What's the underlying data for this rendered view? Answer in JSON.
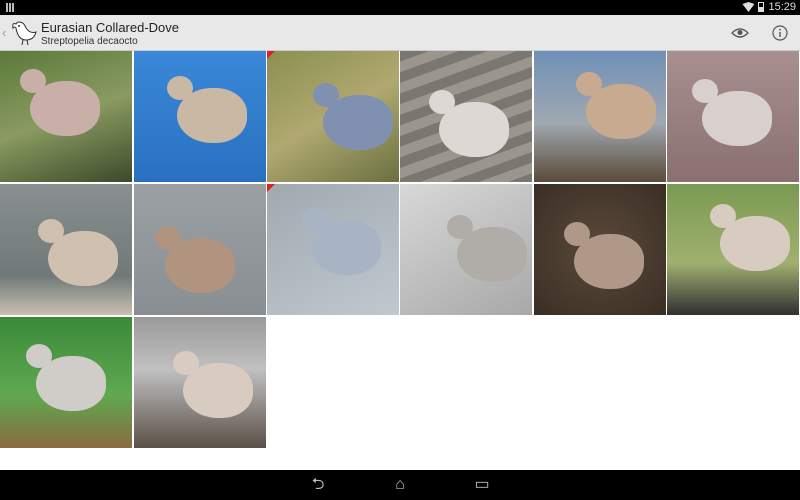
{
  "status_bar": {
    "time": "15:29"
  },
  "header": {
    "title": "Eurasian Collared-Dove",
    "subtitle": "Streptopelia decaocto"
  },
  "photos": [
    {
      "bg": "linear-gradient(160deg,#5a7a3a,#8a9a60 50%,#3a4a2a)",
      "bird": "#c8b0a8",
      "flag": false
    },
    {
      "bg": "linear-gradient(180deg,#3a88d8,#2a70c0)",
      "bird": "#c9b8a4",
      "flag": false
    },
    {
      "bg": "linear-gradient(150deg,#8a9050,#b0a870 50%,#6a7040)",
      "bird": "#8090b0",
      "flag": true
    },
    {
      "bg": "repeating-linear-gradient(160deg,#7a7670 0 10px,#9a968e 10px 20px)",
      "bird": "#ddd8d4",
      "flag": false
    },
    {
      "bg": "linear-gradient(180deg,#7090b8,#a0a8b0 55%,#5a4a3a)",
      "bird": "#c8aa90",
      "flag": false
    },
    {
      "bg": "linear-gradient(180deg,#a89090,#8a7070)",
      "bird": "#d8d0cc",
      "flag": false
    },
    {
      "bg": "linear-gradient(180deg,#8a9090,#707878 70%,#c8c0b0)",
      "bird": "#d0c0b0",
      "flag": false
    },
    {
      "bg": "linear-gradient(180deg,#9aa0a4,#888e92)",
      "bird": "#b09480",
      "flag": false
    },
    {
      "bg": "linear-gradient(150deg,#a0a8b0,#c0c8d0)",
      "bird": "#a8b4c4",
      "flag": true
    },
    {
      "bg": "linear-gradient(150deg,#d8d8d8,#a8a8a8)",
      "bird": "#b0aca8",
      "flag": false
    },
    {
      "bg": "radial-gradient(#5a4a3a,#3a2e24)",
      "bird": "#b09888",
      "flag": false
    },
    {
      "bg": "linear-gradient(180deg,#7a9a50,#a0b070 60%,#303030)",
      "bird": "#d8ccc0",
      "flag": false
    },
    {
      "bg": "linear-gradient(180deg,#3a8a3a,#60a850 60%,#8a6a40)",
      "bird": "#d0ccc8",
      "flag": false
    },
    {
      "bg": "linear-gradient(180deg,#9a9a9a,#c0c0c0 40%,#5a5048)",
      "bird": "#d8ccc0",
      "flag": false
    }
  ]
}
